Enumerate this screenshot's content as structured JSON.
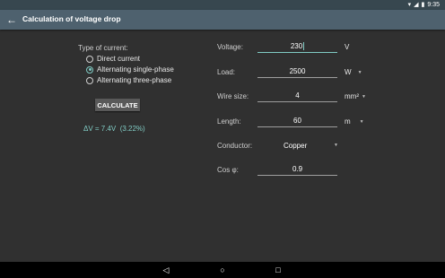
{
  "status": {
    "time": "9:35"
  },
  "appbar": {
    "title": "Calculation of voltage drop"
  },
  "current": {
    "label": "Type of current:",
    "options": [
      "Direct current",
      "Alternating single-phase",
      "Alternating three-phase"
    ],
    "selected_index": 1
  },
  "calculate_label": "CALCULATE",
  "result": "ΔV = 7.4V  (3.22%)",
  "fields": {
    "voltage": {
      "label": "Voltage:",
      "value": "230",
      "unit": "V"
    },
    "load": {
      "label": "Load:",
      "value": "2500",
      "unit": "W"
    },
    "wire_size": {
      "label": "Wire size:",
      "value": "4",
      "unit": "mm²"
    },
    "length": {
      "label": "Length:",
      "value": "60",
      "unit": "m"
    },
    "conductor": {
      "label": "Conductor:",
      "value": "Copper"
    },
    "cos_phi": {
      "label": "Cos φ:",
      "value": "0.9"
    }
  },
  "icons": {
    "back": "arrow-back-icon",
    "wifi": "wifi-icon",
    "signal": "signal-icon",
    "battery": "battery-icon",
    "nav_back": "nav-back-icon",
    "nav_home": "nav-home-icon",
    "nav_recent": "nav-recent-icon"
  },
  "colors": {
    "appbar": "#4e616e",
    "accent": "#80cbc4",
    "background": "#303030"
  }
}
